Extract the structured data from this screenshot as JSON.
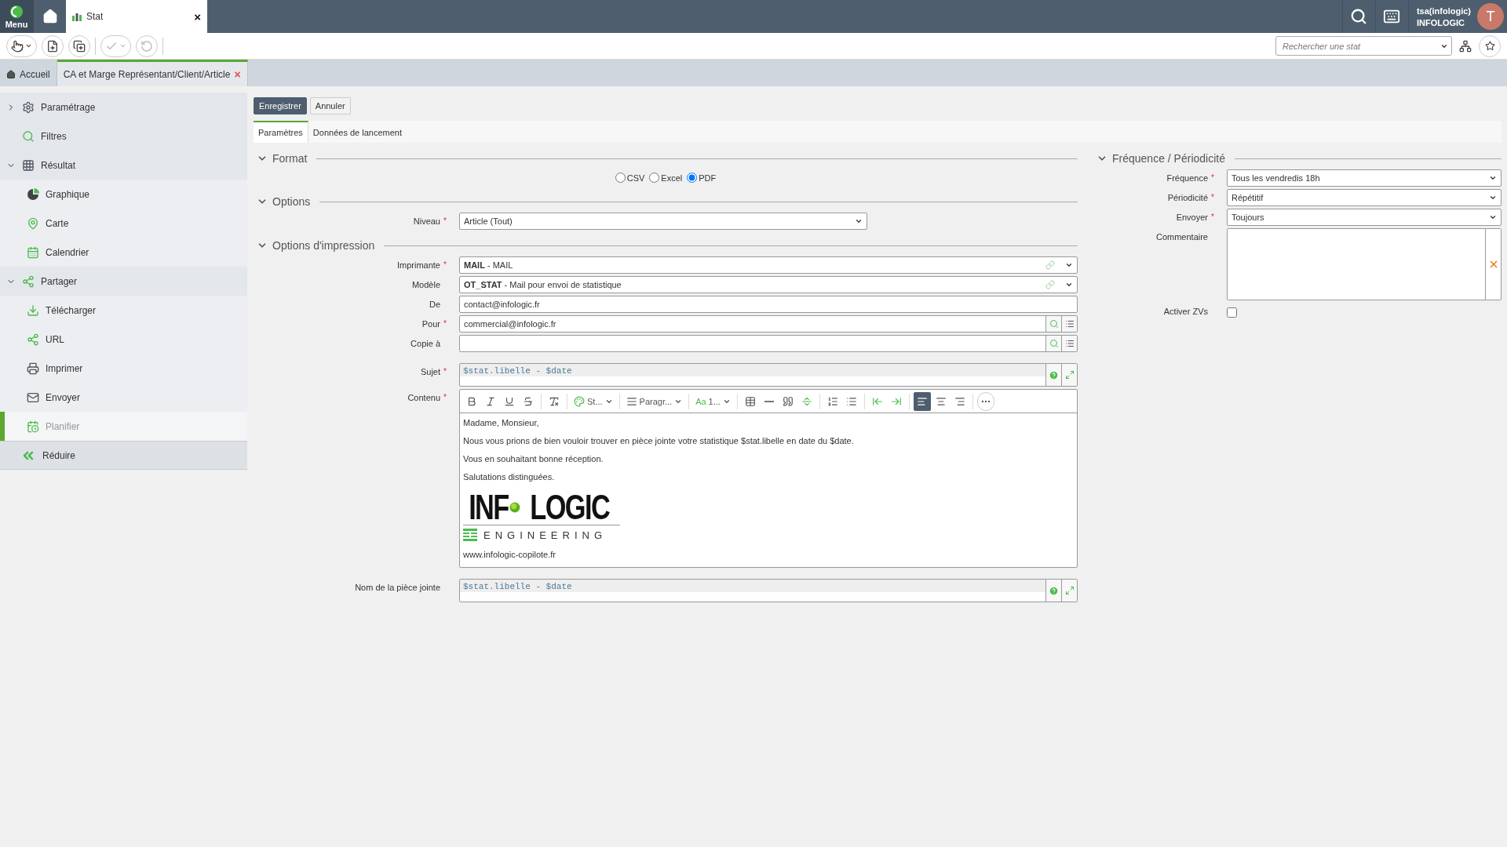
{
  "topbar": {
    "menu_label": "Menu",
    "tab": {
      "label": "Stat",
      "close": "×"
    },
    "user": {
      "name": "tsa(infologic)",
      "company": "INFOLOGIC",
      "initial": "T"
    }
  },
  "required_mark": "*",
  "toolbar": {
    "buttons": [
      {
        "kind": "pointer",
        "disabled": false,
        "caret": true
      },
      {
        "kind": "new",
        "disabled": false
      },
      {
        "kind": "copy",
        "disabled": false
      },
      {
        "kind": "validate",
        "disabled": true,
        "caret": true
      },
      {
        "kind": "undo",
        "disabled": true
      }
    ],
    "search": {
      "placeholder": "Rechercher une stat"
    }
  },
  "doc_tabs": [
    {
      "kind": "home",
      "label": "Accueil",
      "selected": false
    },
    {
      "kind": "doc",
      "label": "CA et Marge Représentant/Client/Article",
      "selected": true,
      "close": "×"
    }
  ],
  "sidebar": {
    "items": [
      {
        "kind": "settings",
        "label": "Paramétrage",
        "expanded": false,
        "selected": false
      },
      {
        "kind": "filter",
        "label": "Filtres",
        "selected": false
      },
      {
        "kind": "table",
        "label": "Résultat",
        "expanded": true,
        "selected": false,
        "children": [
          {
            "kind": "pie",
            "label": "Graphique",
            "selected": false
          },
          {
            "kind": "map",
            "label": "Carte",
            "selected": false
          },
          {
            "kind": "calendar",
            "label": "Calendrier",
            "selected": false
          }
        ]
      },
      {
        "kind": "share",
        "label": "Partager",
        "expanded": true,
        "selected": false,
        "children": [
          {
            "kind": "download",
            "label": "Télécharger",
            "selected": false
          },
          {
            "kind": "share",
            "label": "URL",
            "selected": false
          },
          {
            "kind": "print",
            "label": "Imprimer",
            "selected": false
          },
          {
            "kind": "mail",
            "label": "Envoyer",
            "selected": false
          }
        ]
      },
      {
        "kind": "schedule",
        "label": "Planifier",
        "selected": true
      }
    ],
    "collapse": "Réduire"
  },
  "actions": [
    {
      "label": "Enregistrer",
      "primary": true
    },
    {
      "label": "Annuler",
      "primary": false
    }
  ],
  "form_tabs": [
    {
      "label": "Paramètres",
      "selected": true
    },
    {
      "label": "Données de lancement",
      "selected": false
    }
  ],
  "format": {
    "title": "Format",
    "expanded": true,
    "options": [
      {
        "label": "CSV",
        "selected": false
      },
      {
        "label": "Excel",
        "selected": false
      },
      {
        "label": "PDF",
        "selected": true
      }
    ]
  },
  "options": {
    "title": "Options",
    "expanded": true,
    "fields": [
      {
        "kind": "select",
        "label": "Niveau",
        "required": true,
        "compact": true,
        "value": "Article (Tout)"
      }
    ]
  },
  "print_options": {
    "title": "Options d'impression",
    "expanded": true,
    "fields": [
      {
        "kind": "linked_select",
        "label": "Imprimante",
        "required": true,
        "value": "**MAIL** - MAIL"
      },
      {
        "kind": "linked_select",
        "label": "Modèle",
        "required": false,
        "value": "**OT_STAT** - Mail pour envoi de statistique"
      },
      {
        "kind": "text",
        "label": "De",
        "required": false,
        "value": "contact@infologic.fr"
      },
      {
        "kind": "lookup",
        "label": "Pour",
        "required": true,
        "value": "commercial@infologic.fr"
      },
      {
        "kind": "lookup",
        "label": "Copie à",
        "required": false
      },
      {
        "kind": "template",
        "label": "Sujet",
        "required": true,
        "value": "$stat.libelle - $date"
      },
      {
        "kind": "editor",
        "label": "Contenu",
        "required": true,
        "toolbar": [
          {
            "kind": "bold"
          },
          {
            "kind": "italic"
          },
          {
            "kind": "underline"
          },
          {
            "kind": "strike"
          },
          {
            "kind": "separator"
          },
          {
            "kind": "clear"
          },
          {
            "kind": "separator"
          },
          {
            "kind": "style",
            "text": "St..."
          },
          {
            "kind": "separator"
          },
          {
            "kind": "paragraph",
            "text": "Paragr..."
          },
          {
            "kind": "separator"
          },
          {
            "kind": "size",
            "prefix": "Aa",
            "text": "1..."
          },
          {
            "kind": "separator"
          },
          {
            "kind": "table"
          },
          {
            "kind": "rule"
          },
          {
            "kind": "quote"
          },
          {
            "kind": "pagebreak"
          },
          {
            "kind": "separator"
          },
          {
            "kind": "ordered"
          },
          {
            "kind": "bullets"
          },
          {
            "kind": "separator"
          },
          {
            "kind": "outdent"
          },
          {
            "kind": "indent"
          },
          {
            "kind": "separator"
          },
          {
            "kind": "align_left",
            "selected": true
          },
          {
            "kind": "align_center",
            "selected": false
          },
          {
            "kind": "align_right",
            "selected": false
          },
          {
            "kind": "separator"
          },
          {
            "kind": "more"
          }
        ],
        "paragraphs": [
          "Madame, Monsieur,",
          "Nous vous prions de bien vouloir trouver en pièce jointe votre statistique $stat.libelle en date du $date.",
          "Vous en souhaitant bonne réception.",
          "Salutations distinguées."
        ],
        "logo": {
          "left": "INF",
          "right": "LOGIC",
          "tagline": "ENGINEERING"
        },
        "footer": "www.infologic-copilote.fr"
      },
      {
        "kind": "template",
        "label": "Nom de la pièce jointe",
        "required": false,
        "value": "$stat.libelle - $date"
      }
    ]
  },
  "frequency": {
    "title": "Fréquence / Périodicité",
    "expanded": true,
    "fields": [
      {
        "kind": "select",
        "label": "Fréquence",
        "required": true,
        "value": "Tous les vendredis 18h"
      },
      {
        "kind": "select",
        "label": "Périodicité",
        "required": true,
        "value": "Répétitif"
      },
      {
        "kind": "select",
        "label": "Envoyer",
        "required": true,
        "value": "Toujours"
      },
      {
        "kind": "textarea",
        "label": "Commentaire",
        "required": false
      },
      {
        "kind": "checkbox",
        "label": "Activer ZVs",
        "required": false,
        "checked": false
      }
    ]
  }
}
